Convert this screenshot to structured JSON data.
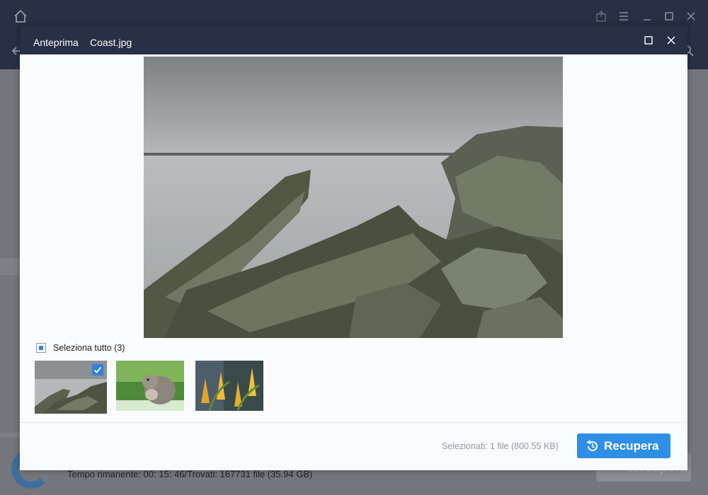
{
  "dialog": {
    "title": "Anteprima",
    "filename": "Coast.jpg"
  },
  "selection": {
    "select_all_label": "Seleziona tutto",
    "count_label": "(3)",
    "selected_info": "Selezionati: 1 file (800.55 KB)"
  },
  "thumbnails": [
    {
      "name": "coast",
      "checked": true
    },
    {
      "name": "squirrel",
      "checked": false
    },
    {
      "name": "yellow-flowers",
      "checked": false
    }
  ],
  "actions": {
    "recover_label": "Recupera"
  },
  "background_app": {
    "status_text": "Tempo rimanente: 00: 15: 46/Trovati: 167731 file (35.94 GB)",
    "recover_label": "Recupera"
  },
  "icons": {
    "home": "home-icon",
    "back": "back-arrow-icon",
    "search": "search-icon",
    "maximize": "maximize-icon",
    "close": "close-icon",
    "recover": "history-restore-icon",
    "check": "check-icon"
  },
  "colors": {
    "header": "#283046",
    "accent": "#2f8ee6",
    "checkbox": "#2f80e0",
    "muted_text": "#8e99a8"
  }
}
